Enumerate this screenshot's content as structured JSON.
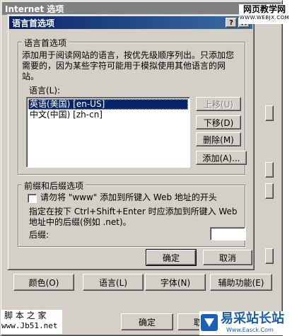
{
  "back_window": {
    "title": "Internet 选项",
    "bottom_buttons": [
      {
        "label": "颜色(O)"
      },
      {
        "label": "语言(L)"
      },
      {
        "label": "字体(N)"
      },
      {
        "label": "辅助功能(E)"
      }
    ],
    "ok_label": "确定",
    "cancel_label": "取"
  },
  "dialog": {
    "title": "语言首选项",
    "help_glyph": "?",
    "close_glyph": "×",
    "lang_group": {
      "legend": "语言首选项",
      "description": "添加用于阅读网站的语言，按优先级顺序列出。只添加您需要的，因为某些字符可能用于模拟使用其他语言的网站。",
      "list_label": "语言(L):",
      "languages": [
        "英语(美国) [en-US]",
        "中文(中国) [zh-cn]"
      ],
      "selected_index": 0,
      "move_up_label": "上移(U)",
      "move_down_label": "下移(D)",
      "remove_label": "删除(M)",
      "add_label": "添加(A)..."
    },
    "prefix_group": {
      "legend": "前缀和后缀选项",
      "checkbox_label": "请勿将 \"www\" 添加到所键入 Web 地址的开头",
      "checkbox_checked": false,
      "note": "指定在按下 Ctrl+Shift+Enter 时应添加到所键入 Web 地址中的后缀(例如 .net)。",
      "suffix_label": "后缀:",
      "suffix_value": ""
    },
    "ok_label": "确定",
    "cancel_label": "取消"
  },
  "watermarks": {
    "top_right": "网页教学网",
    "top_right_url": "WWW.WEBJX.COM",
    "bottom_left": "脚 本 之 家",
    "bottom_left_url": "www.Jb51.net",
    "bottom_right": "易采站长站",
    "bottom_right_url": "Www.Easck.Com"
  },
  "colors": {
    "titlebar_active": "#0a246a",
    "titlebar_inactive": "#808080",
    "face": "#d4d0c8",
    "selection": "#0a246a"
  }
}
